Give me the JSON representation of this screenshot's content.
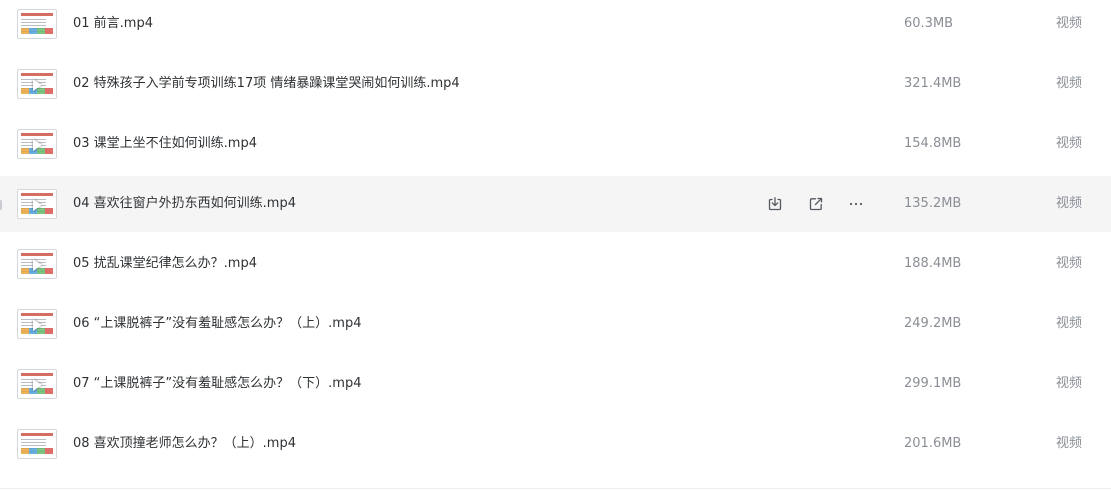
{
  "files": [
    {
      "name": "01 前言.mp4",
      "size": "60.3MB",
      "type": "视频",
      "thumb_icon": "video-thumbnail-icon",
      "hovered": false
    },
    {
      "name": "02 特殊孩子入学前专项训练17项 情绪暴躁课堂哭闹如何训练.mp4",
      "size": "321.4MB",
      "type": "视频",
      "thumb_icon": "video-thumbnail-icon",
      "hovered": false
    },
    {
      "name": "03 课堂上坐不住如何训练.mp4",
      "size": "154.8MB",
      "type": "视频",
      "thumb_icon": "video-thumbnail-icon",
      "hovered": false
    },
    {
      "name": "04 喜欢往窗户外扔东西如何训练.mp4",
      "size": "135.2MB",
      "type": "视频",
      "thumb_icon": "video-thumbnail-icon",
      "hovered": true
    },
    {
      "name": "05 扰乱课堂纪律怎么办？.mp4",
      "size": "188.4MB",
      "type": "视频",
      "thumb_icon": "video-thumbnail-icon",
      "hovered": false
    },
    {
      "name": "06 “上课脱裤子”没有羞耻感怎么办？（上）.mp4",
      "size": "249.2MB",
      "type": "视频",
      "thumb_icon": "video-thumbnail-icon",
      "hovered": false
    },
    {
      "name": "07 “上课脱裤子”没有羞耻感怎么办？（下）.mp4",
      "size": "299.1MB",
      "type": "视频",
      "thumb_icon": "video-thumbnail-icon",
      "hovered": false
    },
    {
      "name": "08 喜欢顶撞老师怎么办？（上）.mp4",
      "size": "201.6MB",
      "type": "视频",
      "thumb_icon": "video-thumbnail-icon",
      "hovered": false
    }
  ],
  "row_actions": {
    "download_icon": "download-icon",
    "share_icon": "share-icon",
    "more_icon": "more-icon",
    "more_glyph": "···"
  },
  "colors": {
    "hover_background": "#f5f5f6",
    "file_name": "#2f3235",
    "secondary_text": "#8a8f96",
    "icon": "#555a60"
  }
}
